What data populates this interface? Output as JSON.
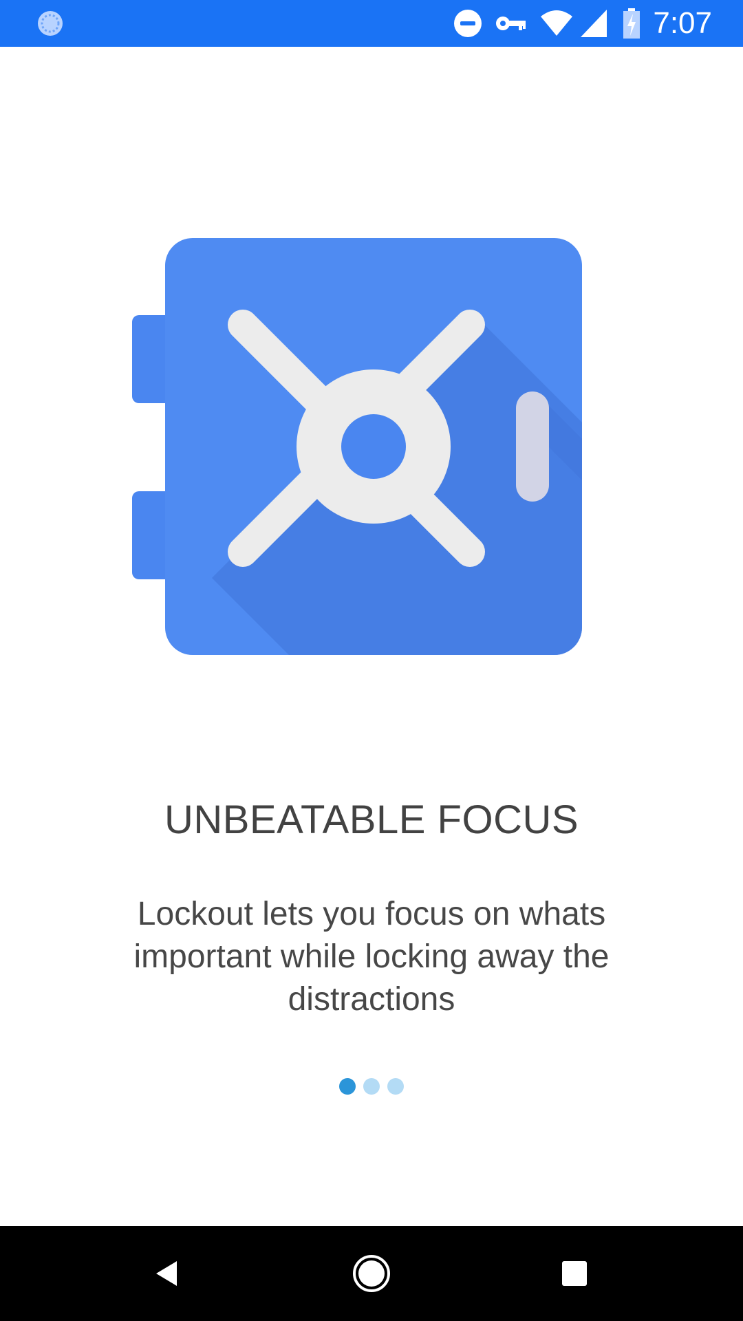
{
  "status_bar": {
    "time": "7:07",
    "background_color": "#1a73f5",
    "icons": [
      "sync-icon",
      "do-not-disturb-icon",
      "vpn-key-icon",
      "wifi-icon",
      "cell-signal-icon",
      "battery-charging-icon"
    ]
  },
  "illustration": {
    "icon": "safe-vault-icon",
    "color": "#4a86f0"
  },
  "onboarding": {
    "title": "UNBEATABLE FOCUS",
    "description": "Lockout lets you focus on whats important while locking away the distractions"
  },
  "page_indicator": {
    "total_pages": 3,
    "current_page": 1,
    "active_color": "#2b95d9",
    "inactive_color": "#b3dbf5"
  },
  "nav_bar": {
    "buttons": [
      "back-icon",
      "home-icon",
      "recents-icon"
    ]
  }
}
